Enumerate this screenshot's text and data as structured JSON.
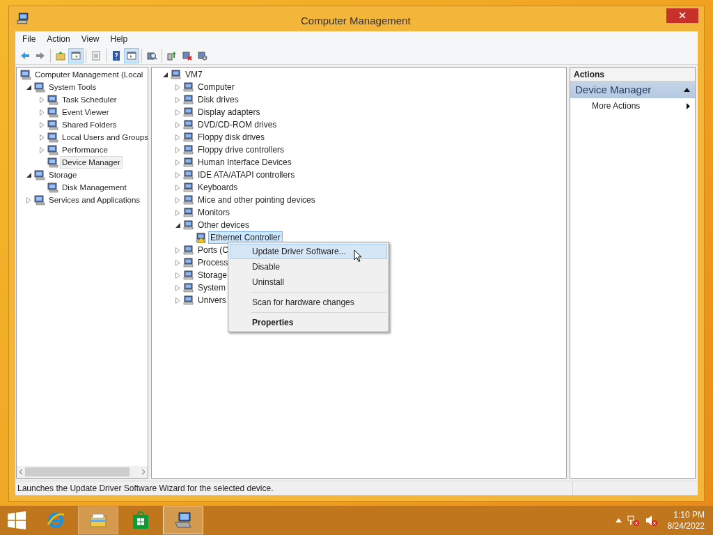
{
  "window": {
    "title": "Computer Management"
  },
  "menu": [
    "File",
    "Action",
    "View",
    "Help"
  ],
  "toolbar": [
    [
      {
        "kind": "back",
        "pressed": false
      },
      {
        "kind": "forward",
        "pressed": false
      }
    ],
    [
      {
        "kind": "folder-up",
        "pressed": false
      },
      {
        "kind": "console-tree",
        "pressed": true
      }
    ],
    [
      {
        "kind": "list",
        "pressed": false
      }
    ],
    [
      {
        "kind": "help",
        "pressed": false
      },
      {
        "kind": "action-pane",
        "pressed": true
      }
    ],
    [
      {
        "kind": "scan",
        "pressed": false
      }
    ],
    [
      {
        "kind": "update",
        "pressed": false
      },
      {
        "kind": "remove",
        "pressed": false
      },
      {
        "kind": "driver",
        "pressed": false
      }
    ]
  ],
  "console_tree": [
    {
      "label": "Computer Management (Local",
      "selected": false,
      "children": [
        {
          "label": "System Tools",
          "expanded": true,
          "selected": false,
          "children": [
            {
              "label": "Task Scheduler",
              "expanded": false,
              "selected": false
            },
            {
              "label": "Event Viewer",
              "expanded": false,
              "selected": false
            },
            {
              "label": "Shared Folders",
              "expanded": false,
              "selected": false
            },
            {
              "label": "Local Users and Groups",
              "expanded": false,
              "selected": false
            },
            {
              "label": "Performance",
              "expanded": false,
              "selected": false
            },
            {
              "label": "Device Manager",
              "selected": true
            }
          ]
        },
        {
          "label": "Storage",
          "expanded": true,
          "selected": false,
          "children": [
            {
              "label": "Disk Management",
              "selected": false
            }
          ]
        },
        {
          "label": "Services and Applications",
          "expanded": false,
          "selected": false
        }
      ]
    }
  ],
  "device_tree": [
    {
      "label": "VM7",
      "expanded": true,
      "selected": false,
      "problem": false,
      "children": [
        {
          "label": "Computer",
          "expanded": false,
          "selected": false,
          "problem": false
        },
        {
          "label": "Disk drives",
          "expanded": false,
          "selected": false,
          "problem": false
        },
        {
          "label": "Display adapters",
          "expanded": false,
          "selected": false,
          "problem": false
        },
        {
          "label": "DVD/CD-ROM drives",
          "expanded": false,
          "selected": false,
          "problem": false
        },
        {
          "label": "Floppy disk drives",
          "expanded": false,
          "selected": false,
          "problem": false
        },
        {
          "label": "Floppy drive controllers",
          "expanded": false,
          "selected": false,
          "problem": false
        },
        {
          "label": "Human Interface Devices",
          "expanded": false,
          "selected": false,
          "problem": false
        },
        {
          "label": "IDE ATA/ATAPI controllers",
          "expanded": false,
          "selected": false,
          "problem": false
        },
        {
          "label": "Keyboards",
          "expanded": false,
          "selected": false,
          "problem": false
        },
        {
          "label": "Mice and other pointing devices",
          "expanded": false,
          "selected": false,
          "problem": false
        },
        {
          "label": "Monitors",
          "expanded": false,
          "selected": false,
          "problem": false
        },
        {
          "label": "Other devices",
          "expanded": true,
          "selected": false,
          "problem": false,
          "children": [
            {
              "label": "Ethernet Controller",
              "selected": true,
              "problem": true
            }
          ]
        },
        {
          "label": "Ports (C",
          "expanded": false,
          "selected": false,
          "problem": false
        },
        {
          "label": "Process",
          "expanded": false,
          "selected": false,
          "problem": false
        },
        {
          "label": "Storage",
          "expanded": false,
          "selected": false,
          "problem": false
        },
        {
          "label": "System",
          "expanded": false,
          "selected": false,
          "problem": false
        },
        {
          "label": "Univers",
          "expanded": false,
          "selected": false,
          "problem": false
        }
      ]
    }
  ],
  "context_menu": [
    [
      {
        "label": "Update Driver Software...",
        "selected": true,
        "default": false
      },
      {
        "label": "Disable",
        "selected": false,
        "default": false
      },
      {
        "label": "Uninstall",
        "selected": false,
        "default": false
      }
    ],
    [
      {
        "label": "Scan for hardware changes",
        "selected": false,
        "default": false
      }
    ],
    [
      {
        "label": "Properties",
        "selected": false,
        "default": true
      }
    ]
  ],
  "actions": {
    "title": "Actions",
    "sections": [
      {
        "label": "Device Manager",
        "expanded": true,
        "items": [
          {
            "label": "More Actions"
          }
        ]
      }
    ]
  },
  "status_bar": "Launches the Update Driver Software Wizard for the selected device.",
  "taskbar": {
    "apps": [
      {
        "kind": "ie",
        "running": false,
        "active": false
      },
      {
        "kind": "explorer",
        "running": true,
        "active": false
      },
      {
        "kind": "store",
        "running": false,
        "active": false
      },
      {
        "kind": "mmc",
        "running": true,
        "active": true
      }
    ],
    "time": "1:10 PM",
    "date": "8/24/2022"
  }
}
